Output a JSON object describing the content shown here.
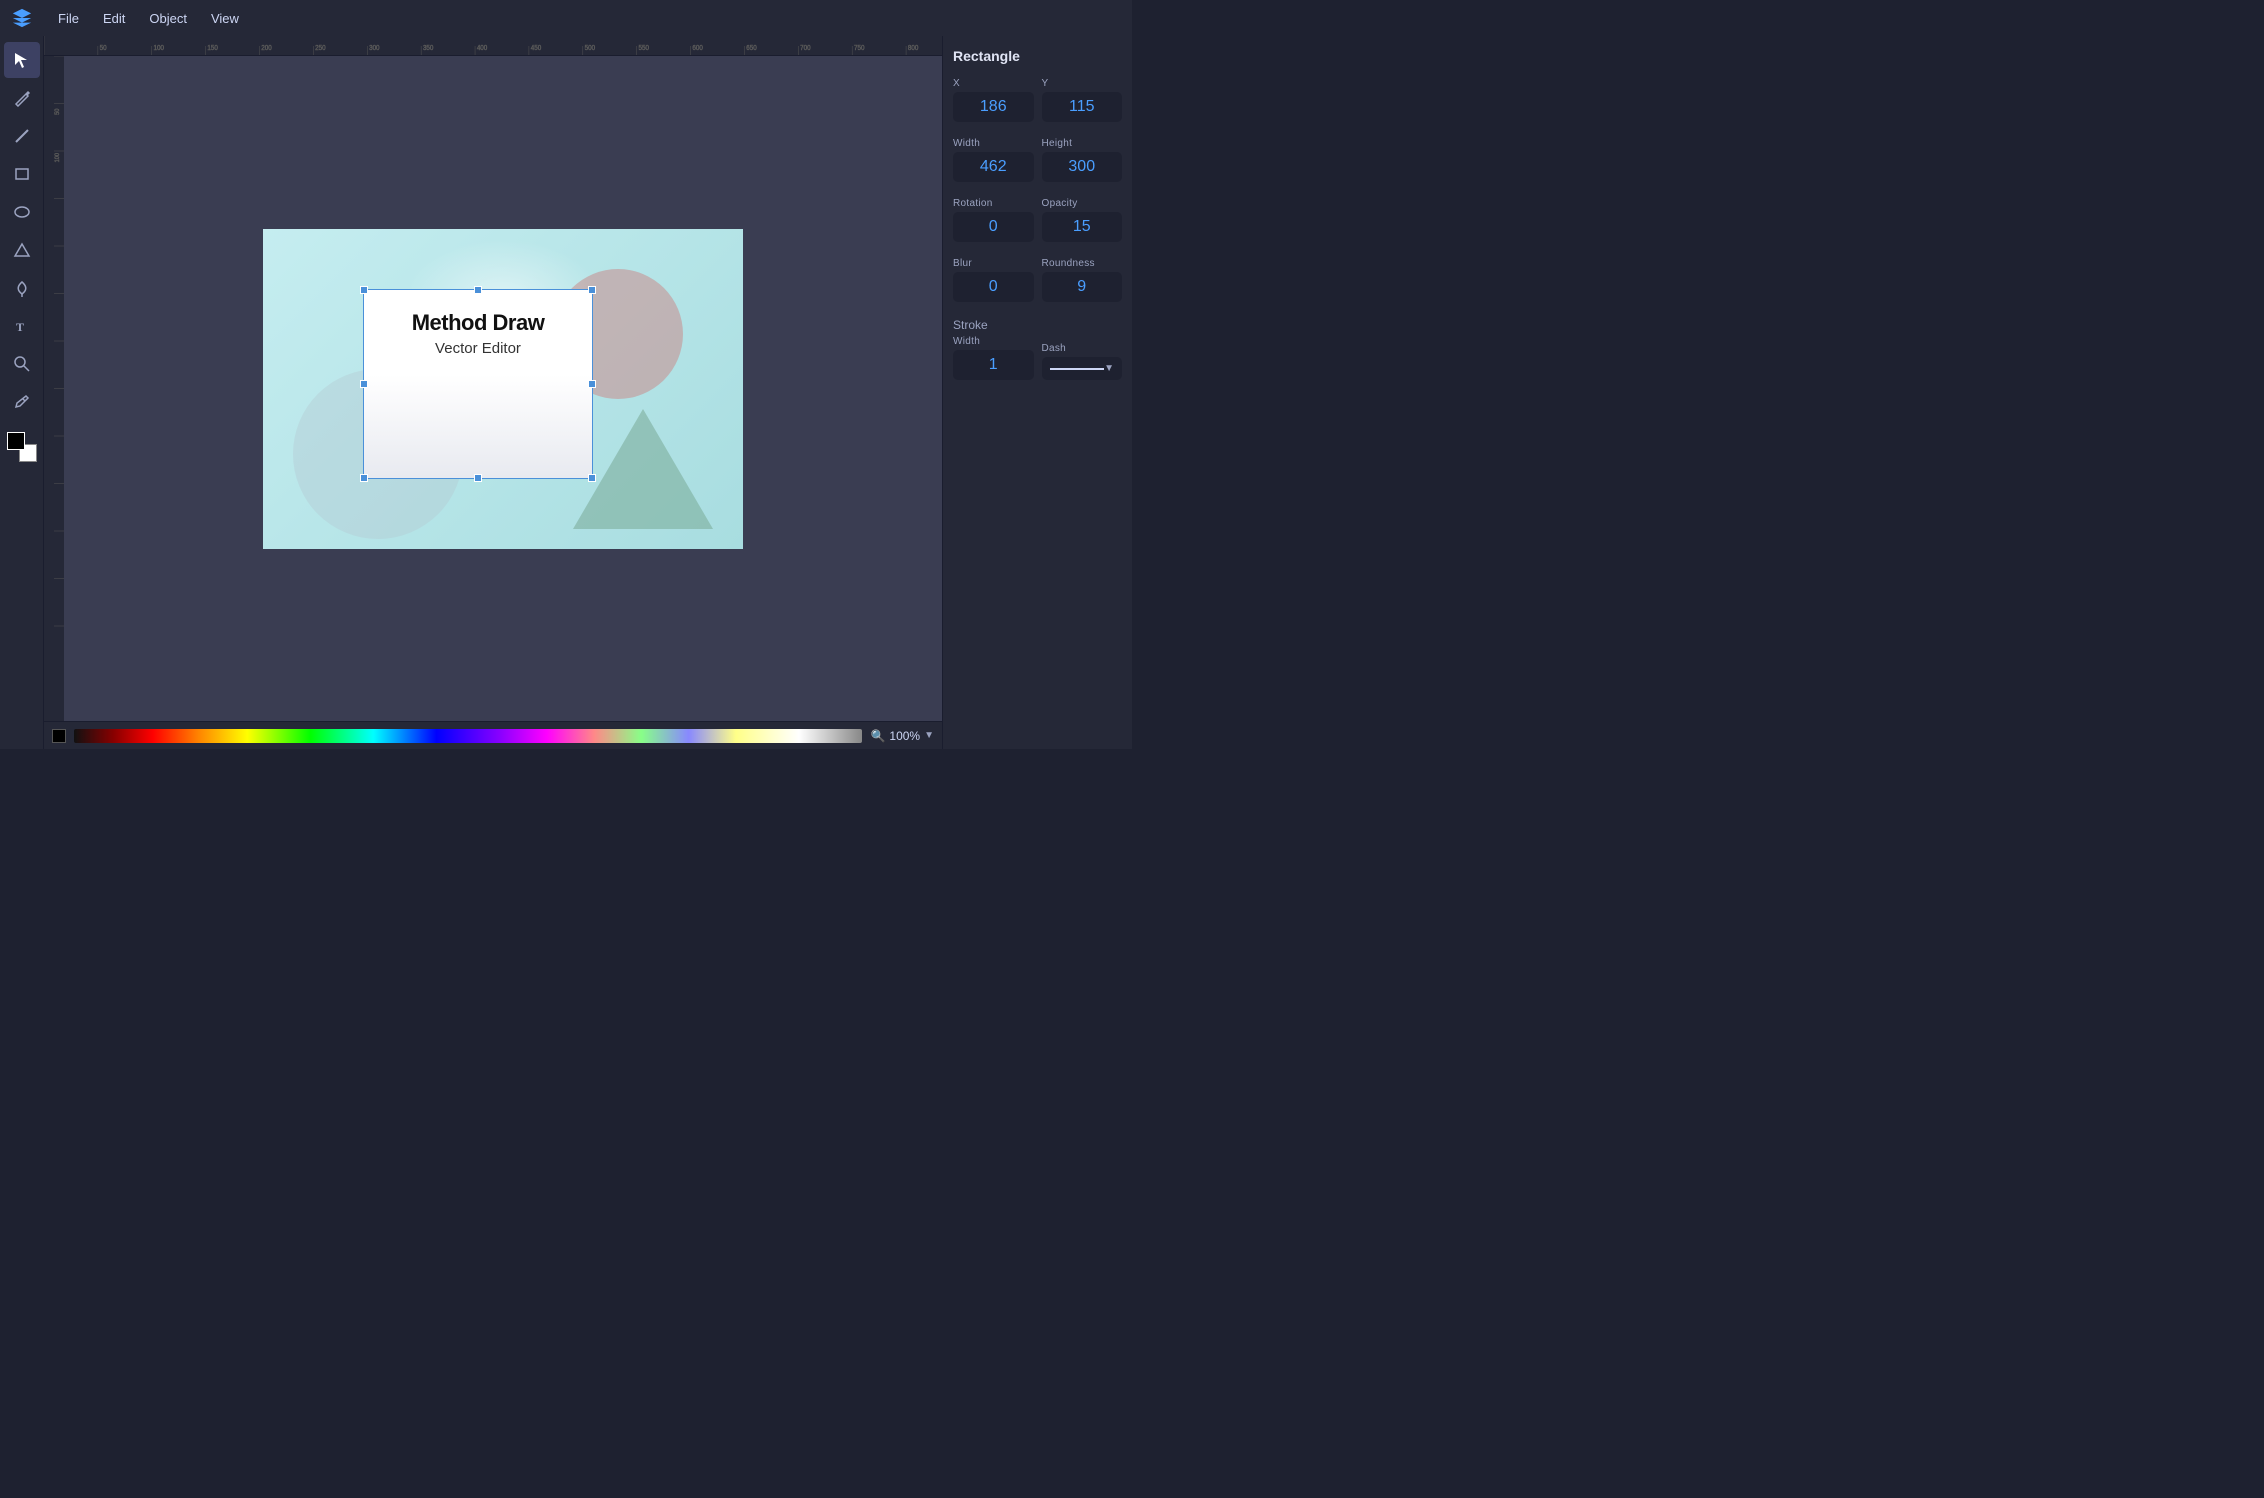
{
  "menubar": {
    "items": [
      "File",
      "Edit",
      "Object",
      "View"
    ]
  },
  "tools": [
    {
      "name": "select",
      "icon": "arrow",
      "active": true
    },
    {
      "name": "pencil",
      "icon": "pencil"
    },
    {
      "name": "line",
      "icon": "line"
    },
    {
      "name": "rectangle",
      "icon": "rect"
    },
    {
      "name": "ellipse",
      "icon": "ellipse"
    },
    {
      "name": "triangle",
      "icon": "triangle"
    },
    {
      "name": "pen",
      "icon": "pen"
    },
    {
      "name": "text",
      "icon": "text"
    },
    {
      "name": "zoom",
      "icon": "zoom"
    },
    {
      "name": "eyedropper",
      "icon": "eye"
    }
  ],
  "panel": {
    "title": "Rectangle",
    "x": {
      "label": "X",
      "value": "186"
    },
    "y": {
      "label": "Y",
      "value": "115"
    },
    "width": {
      "label": "Width",
      "value": "462"
    },
    "height": {
      "label": "Height",
      "value": "300"
    },
    "rotation": {
      "label": "Rotation",
      "value": "0"
    },
    "opacity": {
      "label": "Opacity",
      "value": "15"
    },
    "blur": {
      "label": "Blur",
      "value": "0"
    },
    "roundness": {
      "label": "Roundness",
      "value": "9"
    },
    "stroke": {
      "label": "Stroke",
      "width_label": "Width",
      "width_value": "1",
      "dash_label": "Dash",
      "dash_value": "—"
    }
  },
  "canvas": {
    "title_line1": "Method Draw",
    "title_line2": "Vector Editor"
  },
  "bottombar": {
    "zoom_value": "100%",
    "zoom_icon": "🔍"
  }
}
